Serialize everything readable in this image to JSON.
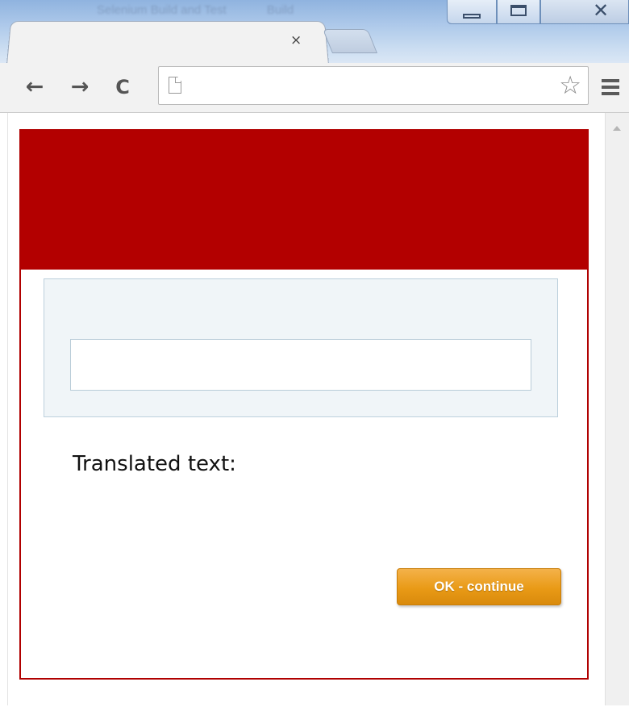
{
  "window": {
    "title": "Selenium Build and Test",
    "title_right": "Build",
    "minimize_icon": "minimize-icon",
    "maximize_icon": "maximize-icon",
    "close_icon": "close-window-icon"
  },
  "tabs": [
    {
      "label": "",
      "close_glyph": "×"
    }
  ],
  "toolbar": {
    "back_glyph": "←",
    "forward_glyph": "→",
    "reload_glyph": "C",
    "address_value": "",
    "bookmark_glyph": "☆"
  },
  "page": {
    "input_value": "",
    "translated_label": "Translated text:",
    "ok_button_label": "OK - continue"
  },
  "colors": {
    "header_red": "#b30000",
    "border_red": "#b00000",
    "button_orange": "#e99a16",
    "panel_bg": "#f0f5f8"
  }
}
